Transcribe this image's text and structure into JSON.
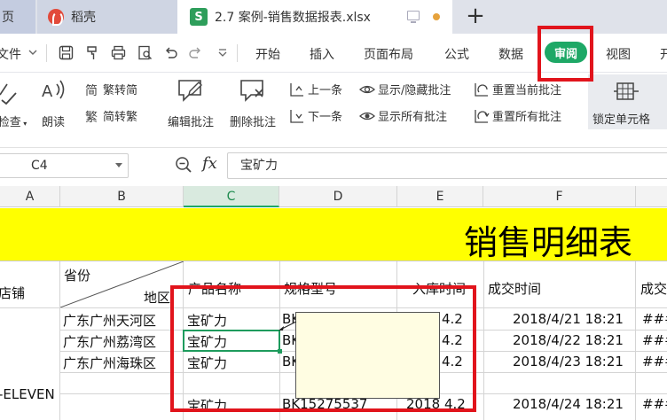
{
  "tabs": {
    "home": "页",
    "daoke": "稻壳",
    "file": "2.7 案例-销售数据报表.xlsx",
    "add": "+"
  },
  "menu": {
    "file": "文件",
    "items": [
      "开始",
      "插入",
      "页面布局",
      "公式",
      "数据",
      "审阅",
      "视图",
      "开"
    ]
  },
  "ribbon": {
    "check": "检查",
    "read_aloud": "朗读",
    "to_traditional": "繁转简",
    "to_simplified": "简转繁",
    "edit_comment": "编辑批注",
    "delete_comment": "删除批注",
    "prev": "上一条",
    "next": "下一条",
    "show_hide": "显示/隐藏批注",
    "show_all": "显示所有批注",
    "reset_current": "重置当前批注",
    "reset_all": "重置所有批注",
    "lock_cell": "锁定单元格"
  },
  "formula": {
    "name_box": "C4",
    "fx": "fx",
    "value": "宝矿力"
  },
  "sheet": {
    "columns": [
      "A",
      "B",
      "C",
      "D",
      "E",
      "F"
    ],
    "title": "销售明细表",
    "headers": {
      "store": "店铺",
      "province": "省份",
      "region": "地区",
      "product": "产品名称",
      "spec": "规格型号",
      "stock_time": "入库时间",
      "deal_time": "成交时间",
      "deal_more": "成交"
    },
    "rows": [
      {
        "region": "广东广州天河区",
        "product": "宝矿力",
        "spec": "BK",
        "stock": "4.2",
        "deal": "2018/4/21  18:21",
        "more": "###"
      },
      {
        "region": "广东广州荔湾区",
        "product": "宝矿力",
        "spec": "BK",
        "stock": "4.2",
        "deal": "2018/4/22  18:21",
        "more": "###"
      },
      {
        "region": "广东广州海珠区",
        "product": "宝矿力",
        "spec": "BK",
        "stock": "4.2",
        "deal": "2018/4/23  18:21",
        "more": "###"
      },
      {
        "region": "",
        "product": "宝矿力",
        "spec": "BK15275537",
        "stock": "2018  4.2",
        "deal": "2018/4/24  18:21",
        "more": "###"
      }
    ],
    "store_value": "-ELEVEN"
  }
}
